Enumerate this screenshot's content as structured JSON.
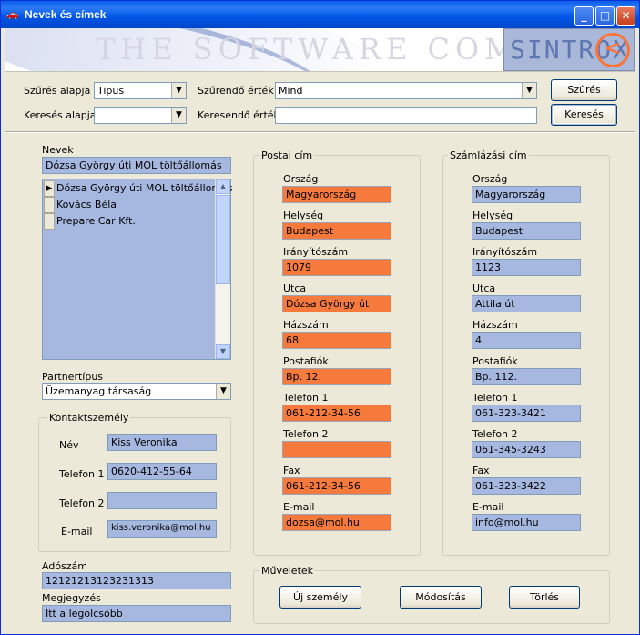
{
  "window": {
    "title": "Nevek és címek"
  },
  "banner": {
    "slogan": "THE SOFTWARE COMPANY...",
    "logo": "SINTROX"
  },
  "filter": {
    "filter_by_label": "Szűrés alapja",
    "filter_by_value": "Tipus",
    "filter_value_label": "Szűrendő érték",
    "filter_value_value": "Mind",
    "filter_button": "Szűrés",
    "search_by_label": "Keresés alapja",
    "search_by_value": "",
    "search_value_label": "Keresendő érték",
    "search_value_value": "",
    "search_button": "Keresés"
  },
  "names": {
    "label": "Nevek",
    "current": "Dózsa György úti MOL töltőállomás",
    "items": [
      "Dózsa György úti MOL töltőállomás",
      "Kovács Béla",
      "Prepare Car Kft."
    ],
    "selected_index": 0
  },
  "partner": {
    "label": "Partnertípus",
    "value": "Üzemanyag társaság"
  },
  "contact": {
    "title": "Kontaktszemély",
    "name_label": "Név",
    "name": "Kiss Veronika",
    "phone1_label": "Telefon 1",
    "phone1": "0620-412-55-64",
    "phone2_label": "Telefon 2",
    "phone2": "",
    "email_label": "E-mail",
    "email": "kiss.veronika@mol.hu"
  },
  "tax": {
    "label": "Adószám",
    "value": "12121213123231313"
  },
  "note": {
    "label": "Megjegyzés",
    "value": "Itt a legolcsóbb"
  },
  "postal": {
    "title": "Postai cím",
    "country_label": "Ország",
    "country": "Magyarország",
    "city_label": "Helység",
    "city": "Budapest",
    "zip_label": "Irányítószám",
    "zip": "1079",
    "street_label": "Utca",
    "street": "Dózsa György út",
    "number_label": "Házszám",
    "number": "68.",
    "pobox_label": "Postafiók",
    "pobox": "Bp. 12.",
    "phone1_label": "Telefon 1",
    "phone1": "061-212-34-56",
    "phone2_label": "Telefon 2",
    "phone2": "",
    "fax_label": "Fax",
    "fax": "061-212-34-56",
    "email_label": "E-mail",
    "email": "dozsa@mol.hu"
  },
  "billing": {
    "title": "Számlázási cím",
    "country_label": "Ország",
    "country": "Magyarország",
    "city_label": "Helység",
    "city": "Budapest",
    "zip_label": "Irányítószám",
    "zip": "1123",
    "street_label": "Utca",
    "street": "Attila út",
    "number_label": "Házszám",
    "number": "4.",
    "pobox_label": "Postafiók",
    "pobox": "Bp. 112.",
    "phone1_label": "Telefon 1",
    "phone1": "061-323-3421",
    "phone2_label": "Telefon 2",
    "phone2": "061-345-3243",
    "fax_label": "Fax",
    "fax": "061-323-3422",
    "email_label": "E-mail",
    "email": "info@mol.hu"
  },
  "actions": {
    "title": "Műveletek",
    "new_person": "Új személy",
    "modify": "Módosítás",
    "delete": "Törlés"
  },
  "colors": {
    "field_blue": "#a6b8e0",
    "field_orange": "#f57a3b"
  }
}
